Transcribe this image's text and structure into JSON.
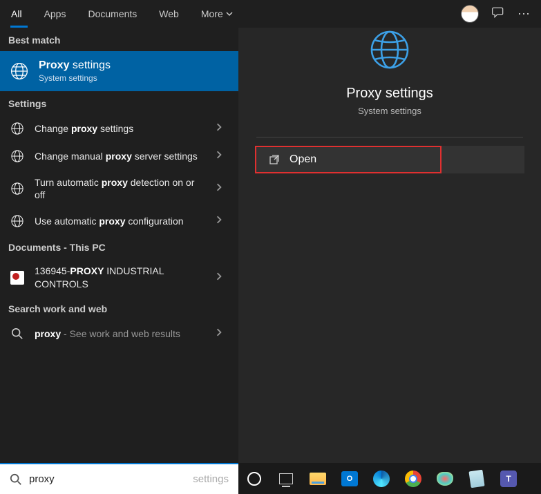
{
  "tabs": {
    "all": "All",
    "apps": "Apps",
    "documents": "Documents",
    "web": "Web",
    "more": "More"
  },
  "sections": {
    "best": "Best match",
    "settings": "Settings",
    "documents": "Documents - This PC",
    "workweb": "Search work and web"
  },
  "best_match": {
    "title_pre": "Proxy",
    "title_post": " settings",
    "sub": "System settings"
  },
  "settings_rows": {
    "r1_pre": "Change ",
    "r1_b": "proxy",
    "r1_post": " settings",
    "r2_pre": "Change manual ",
    "r2_b": "proxy",
    "r2_post": " server settings",
    "r3_pre": "Turn automatic ",
    "r3_b": "proxy",
    "r3_post": " detection on or off",
    "r4_pre": "Use automatic ",
    "r4_b": "proxy",
    "r4_post": " configuration"
  },
  "doc_row": {
    "pre": "136945-",
    "b": "PROXY",
    "post": " INDUSTRIAL CONTROLS"
  },
  "web_row": {
    "b": "proxy",
    "post": " - See work and web results"
  },
  "right": {
    "title": "Proxy settings",
    "sub": "System settings",
    "open": "Open"
  },
  "search": {
    "value": "proxy",
    "placeholder": "settings"
  },
  "icons": {
    "outlook": "O",
    "teams": "T"
  }
}
